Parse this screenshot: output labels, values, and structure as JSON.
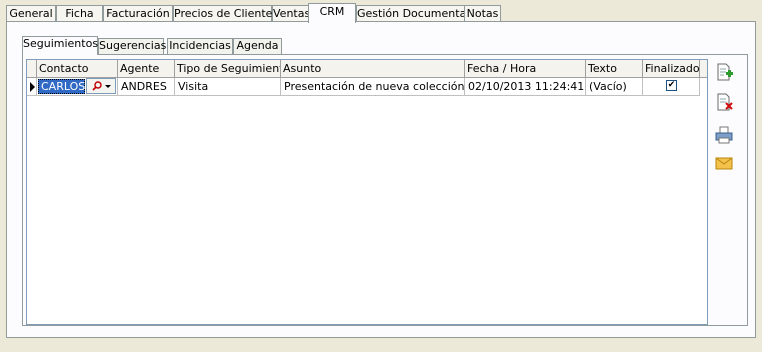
{
  "top_tabs": [
    "General",
    "Ficha",
    "Facturación",
    "Precios de Cliente",
    "Ventas",
    "CRM",
    "Gestión Documental",
    "Notas"
  ],
  "inner_tabs": [
    "Seguimientos",
    "Sugerencias",
    "Incidencias",
    "Agenda"
  ],
  "grid": {
    "columns": [
      "Contacto",
      "Agente",
      "Tipo de Seguimiento",
      "Asunto",
      "Fecha / Hora",
      "Texto",
      "Finalizado"
    ],
    "rows": [
      {
        "contacto": "CARLOS",
        "agente": "ANDRES",
        "tipo": "Visita",
        "asunto": "Presentación de nueva colección",
        "fecha": "02/10/2013 11:24:41",
        "texto": "(Vacío)",
        "finalizado": "✔"
      }
    ]
  },
  "toolbar": [
    "add-document-icon",
    "delete-document-icon",
    "print-icon",
    "email-icon"
  ]
}
